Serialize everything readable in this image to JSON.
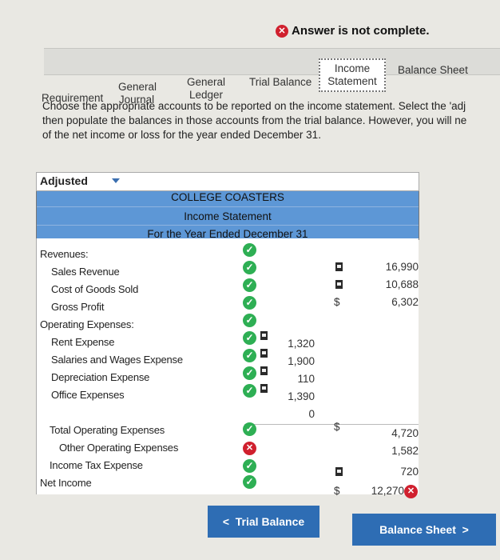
{
  "banner": {
    "icon": "x-circle-icon",
    "text": "Answer is not complete."
  },
  "tabs": [
    {
      "label": "Requirement",
      "active": false
    },
    {
      "label": "General Journal",
      "active": false
    },
    {
      "label": "General Ledger",
      "active": false
    },
    {
      "label": "Trial Balance",
      "active": false
    },
    {
      "label": "Income Statement",
      "active": true
    },
    {
      "label": "Balance Sheet",
      "active": false
    }
  ],
  "instructions": {
    "line1": "Choose the appropriate accounts to be reported on the income statement. Select the 'adj",
    "line2": "then populate the balances in those accounts from the trial balance. However, you will ne",
    "line3": "of the net income or loss for the year ended December 31."
  },
  "statement": {
    "dropdown": "Adjusted",
    "company": "COLLEGE COASTERS",
    "title": "Income Statement",
    "period": "For the Year Ended December 31",
    "rows": {
      "revenues": "Revenues:",
      "sales": {
        "label": "Sales Revenue",
        "sign": "$",
        "value": "16,990"
      },
      "cogs": {
        "label": "Cost of Goods Sold",
        "value": "10,688"
      },
      "gross": {
        "label": "Gross Profit",
        "sign": "$",
        "value": "6,302"
      },
      "opex": "Operating Expenses:",
      "rent": {
        "label": "Rent Expense",
        "value": "1,320"
      },
      "salaries": {
        "label": "Salaries and Wages Expense",
        "value": "1,900"
      },
      "depr": {
        "label": "Depreciation Expense",
        "value": "110"
      },
      "office": {
        "label": "Office Expenses",
        "value": "1,390"
      },
      "blank": {
        "value": "0"
      },
      "total_opex": {
        "label": "Total Operating Expenses",
        "sign": "$",
        "value": "4,720"
      },
      "other": {
        "label": "Other Operating Expenses",
        "value": "1,582"
      },
      "tax": {
        "label": "Income Tax Expense",
        "value": "720"
      },
      "net": {
        "label": "Net Income",
        "sign": "$",
        "value": "12,270"
      }
    }
  },
  "nav": {
    "prev": "Trial Balance",
    "next": "Balance Sheet"
  },
  "colors": {
    "header_blue": "#5d97d6",
    "button_blue": "#2e6db4",
    "check_green": "#2eaf54",
    "error_red": "#d0202e"
  }
}
